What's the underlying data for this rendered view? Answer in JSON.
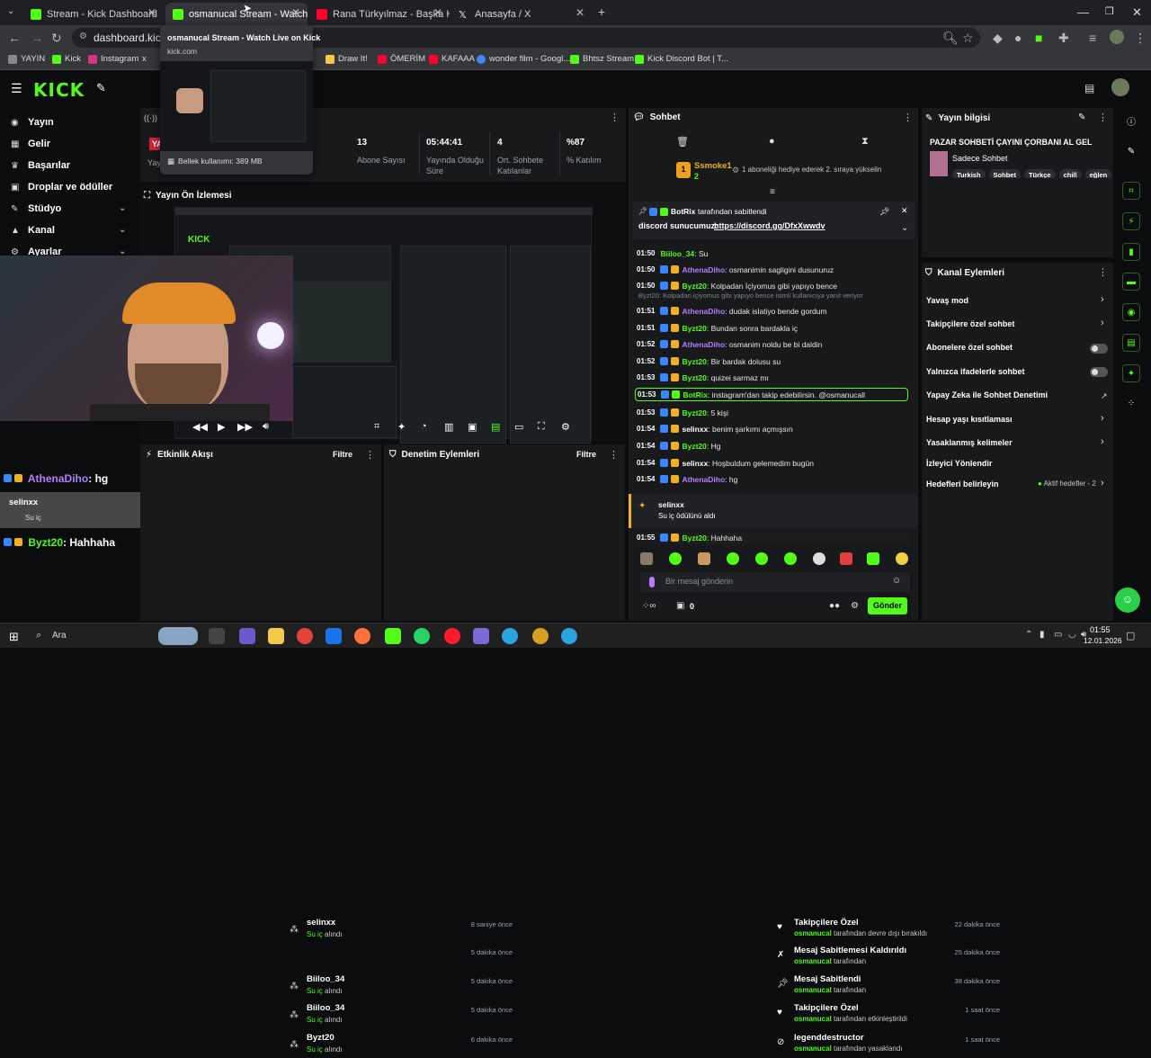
{
  "browser": {
    "tabs": [
      {
        "title": "Stream - Kick Dashboard",
        "color": "#53fc18"
      },
      {
        "title": "osmanucal Stream - Watch Live",
        "color": "#53fc18"
      },
      {
        "title": "Rana Türkyılmaz - Başka Hikaye",
        "color": "#ff0033"
      },
      {
        "title": "Anasayfa / X",
        "color": "#ffffff"
      }
    ],
    "url": "dashboard.kick.co",
    "tooltip": {
      "title": "osmanucal Stream - Watch Live on Kick",
      "domain": "kick.com",
      "memory": "Bellek kullanımı: 389 MB"
    },
    "bookmarks": [
      "YAYIN",
      "Kick",
      "Instagram",
      "x",
      "Draw It!",
      "ÖMERİM",
      "KAFAAA",
      "wonder film - Googl...",
      "Bhtsz Stream",
      "Kick Discord Bot | T..."
    ]
  },
  "sidebar": {
    "items": [
      {
        "label": "Yayın"
      },
      {
        "label": "Gelir"
      },
      {
        "label": "Başarılar"
      },
      {
        "label": "Droplar ve ödüller"
      },
      {
        "label": "Stüdyo"
      },
      {
        "label": "Kanal"
      },
      {
        "label": "Ayarlar"
      }
    ]
  },
  "stats": [
    {
      "value": "13",
      "label": "Abone Sayısı"
    },
    {
      "value": "05:44:41",
      "label": "Yayında Olduğu Süre"
    },
    {
      "value": "4",
      "label": "Ort. Sohbete Katılanlar"
    },
    {
      "value": "%87",
      "label": "% Katılım"
    }
  ],
  "stream_badge": {
    "live": "YA",
    "label": "Yay"
  },
  "preview": {
    "title": "Yayın Ön İzlemesi"
  },
  "overlay_chat": [
    {
      "user": "AthenaDiho",
      "msg": ": hg"
    },
    {
      "user": "selinxx",
      "msg": "Su iç"
    },
    {
      "user": "AthenaDiho",
      "msg": "Su iç alındı"
    },
    {
      "user": "Byzt20",
      "msg": ": Hahhaha"
    }
  ],
  "activity": {
    "title": "Etkinlik Akışı",
    "filter": "Filtre",
    "rows": [
      {
        "name": "selinxx",
        "action": "Su iç",
        "suffix": "alındı",
        "time": "8 saniye önce"
      },
      {
        "name": "",
        "action": "",
        "suffix": "",
        "time": "5 dakika önce"
      },
      {
        "name": "Biiloo_34",
        "action": "Su iç",
        "suffix": "alındı",
        "time": "5 dakika önce"
      },
      {
        "name": "Biiloo_34",
        "action": "Su iç",
        "suffix": "alındı",
        "time": "5 dakika önce"
      },
      {
        "name": "Byzt20",
        "action": "Su iç",
        "suffix": "alındı",
        "time": "6 dakika önce"
      }
    ]
  },
  "moderation": {
    "title": "Denetim Eylemleri",
    "filter": "Filtre",
    "rows": [
      {
        "name": "Takipçilere Özel",
        "by": "osmanucal",
        "desc": "tarafından devre dışı bırakıldı",
        "time": "22 dakika önce"
      },
      {
        "name": "Mesaj Sabitlemesi Kaldırıldı",
        "by": "osmanucal",
        "desc": "tarafından",
        "time": "25 dakika önce"
      },
      {
        "name": "Mesaj Sabitlendi",
        "by": "osmanucal",
        "desc": "tarafından",
        "time": "38 dakika önce"
      },
      {
        "name": "Takipçilere Özel",
        "by": "osmanucal",
        "desc": "tarafından etkinleştirildi",
        "time": "1 saat önce"
      },
      {
        "name": "legenddestructor",
        "by": "osmanucal",
        "desc": "tarafından yasaklandı",
        "time": "1 saat önce"
      }
    ]
  },
  "chat": {
    "title": "Sohbet",
    "gift": {
      "user": "Ssmoke1",
      "count": "2",
      "text": "1 aboneliği hediye ederek 2. sıraya yükselin"
    },
    "pinned": {
      "user": "BotRix",
      "label": "tarafından sabitlendi",
      "text": "discord sunucumuz:",
      "link": "https://discord.gg/DfxXwwdv"
    },
    "messages": [
      {
        "time": "01:50",
        "user": "Biiloo_34",
        "text": ": Su",
        "color": "green"
      },
      {
        "time": "01:50",
        "user": "AthenaDiho",
        "text": ": osmanimin sagligini dusunuruz",
        "color": "purple"
      },
      {
        "time": "01:50",
        "user": "Byzt20",
        "text": ": Kolpadan İçiyomus gibi yapıyo bence",
        "color": "green"
      },
      {
        "time": "",
        "user": "",
        "text": "Byzt20: Kolpadan içiyomus gibi yapıyo bence isimli kullanıcıya yanıt veriyor",
        "color": "reply"
      },
      {
        "time": "01:51",
        "user": "AthenaDiho",
        "text": ": dudak islatiyo bende gordum",
        "color": "purple"
      },
      {
        "time": "01:51",
        "user": "Byzt20",
        "text": ": Bundan sonra bardakla iç",
        "color": "green"
      },
      {
        "time": "01:52",
        "user": "AthenaDiho",
        "text": ": osmanim noldu be bi daldin",
        "color": "purple"
      },
      {
        "time": "01:52",
        "user": "Byzt20",
        "text": ": Bir bardak dolusu su",
        "color": "green"
      },
      {
        "time": "01:53",
        "user": "Byzt20",
        "text": ": quizei sarmaz mı",
        "color": "green"
      },
      {
        "time": "01:53",
        "user": "BotRix",
        "text": ": instagram'dan takip edebilirsin. @osmanucall",
        "color": "bot"
      },
      {
        "time": "01:53",
        "user": "Byzt20",
        "text": ": 5 kişi",
        "color": "green"
      },
      {
        "time": "01:54",
        "user": "selinxx",
        "text": ": benim şarkımı açmışsın",
        "color": "white"
      },
      {
        "time": "01:54",
        "user": "Byzt20",
        "text": ": Hg",
        "color": "green"
      },
      {
        "time": "01:54",
        "user": "selinxx",
        "text": ": Hoşbuldum gelemedim bugün",
        "color": "white"
      },
      {
        "time": "01:54",
        "user": "AthenaDiho",
        "text": ": hg",
        "color": "purple"
      }
    ],
    "redeem": {
      "user": "selinxx",
      "text": "Su iç ödülünü aldı"
    },
    "last": {
      "time": "01:55",
      "user": "Byzt20",
      "text": ": Hahhaha"
    },
    "placeholder": "Bir mesaj gönderin",
    "count": "0",
    "send": "Gönder"
  },
  "stream_info": {
    "title": "Yayın bilgisi",
    "stream_title": "PAZAR SOHBETİ ÇAYINI ÇORBANI AL GEL",
    "category": "Sadece Sohbet",
    "tags": [
      "Turkish",
      "Sohbet",
      "Türkçe",
      "chill",
      "eğlen"
    ]
  },
  "channel_actions": {
    "title": "Kanal Eylemleri",
    "rows": [
      {
        "label": "Yavaş mod"
      },
      {
        "label": "Takipçilere özel sohbet"
      },
      {
        "label": "Abonelere özel sohbet"
      },
      {
        "label": "Yalnızca ifadelerle sohbet"
      },
      {
        "label": "Yapay Zeka ile Sohbet Denetimi"
      },
      {
        "label": "Hesap yaşı kısıtlaması"
      },
      {
        "label": "Yasaklanmış kelimeler"
      },
      {
        "label": "İzleyici Yönlendir"
      },
      {
        "label": "Hedefleri belirleyin"
      }
    ],
    "goals_status": "Aktif hedefler - 2"
  },
  "taskbar": {
    "search": "Ara",
    "time": "01:55",
    "date": "12.01.2026"
  },
  "colors": {
    "accent": "#53fc18",
    "panel": "#18191b",
    "bg": "#0b0c0d",
    "purple": "#b57cff"
  }
}
